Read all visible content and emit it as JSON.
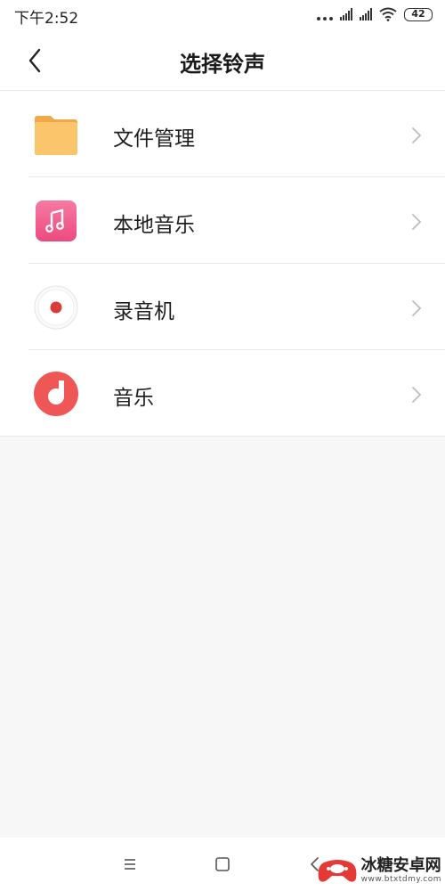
{
  "status_bar": {
    "time": "下午2:52",
    "battery": "42"
  },
  "header": {
    "title": "选择铃声"
  },
  "items": [
    {
      "label": "文件管理",
      "icon": "folder-icon",
      "color": "#f9b85c"
    },
    {
      "label": "本地音乐",
      "icon": "music-note-icon",
      "color": "#f0588a"
    },
    {
      "label": "录音机",
      "icon": "recorder-icon",
      "color": "#d93a3a"
    },
    {
      "label": "音乐",
      "icon": "music-app-icon",
      "color": "#ef5656"
    }
  ],
  "watermark": {
    "text": "冰糖安卓网",
    "url": "www.btxtdmy.com"
  }
}
